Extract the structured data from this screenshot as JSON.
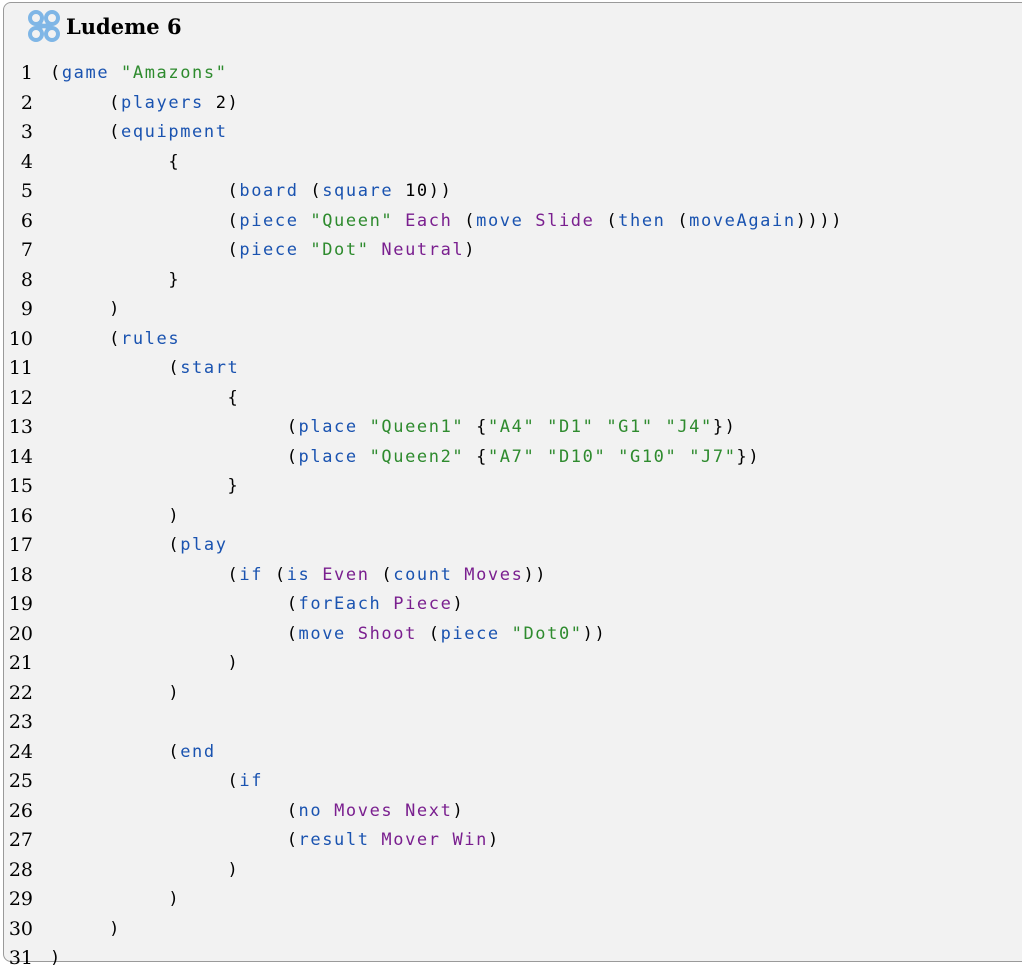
{
  "header": {
    "title": "Ludeme 6",
    "icon": "ludeme-knot-icon"
  },
  "colors": {
    "keyword": "#1a53b0",
    "string": "#2e8b2e",
    "constant": "#7a1f8f",
    "plain": "#000000",
    "background": "#f2f2f2",
    "border": "#9a9a9a"
  },
  "lines": [
    {
      "n": "1",
      "tokens": [
        [
          "p",
          "("
        ],
        [
          "k",
          "game"
        ],
        [
          "p",
          " "
        ],
        [
          "s",
          "\"Amazons\""
        ]
      ]
    },
    {
      "n": "2",
      "tokens": [
        [
          "p",
          "     ("
        ],
        [
          "k",
          "players"
        ],
        [
          "p",
          " 2)"
        ]
      ]
    },
    {
      "n": "3",
      "tokens": [
        [
          "p",
          "     ("
        ],
        [
          "k",
          "equipment"
        ]
      ]
    },
    {
      "n": "4",
      "tokens": [
        [
          "p",
          "          {"
        ]
      ]
    },
    {
      "n": "5",
      "tokens": [
        [
          "p",
          "               ("
        ],
        [
          "k",
          "board"
        ],
        [
          "p",
          " ("
        ],
        [
          "k",
          "square"
        ],
        [
          "p",
          " 10))"
        ]
      ]
    },
    {
      "n": "6",
      "tokens": [
        [
          "p",
          "               ("
        ],
        [
          "k",
          "piece"
        ],
        [
          "p",
          " "
        ],
        [
          "s",
          "\"Queen\""
        ],
        [
          "p",
          " "
        ],
        [
          "c",
          "Each"
        ],
        [
          "p",
          " ("
        ],
        [
          "k",
          "move"
        ],
        [
          "p",
          " "
        ],
        [
          "c",
          "Slide"
        ],
        [
          "p",
          " ("
        ],
        [
          "k",
          "then"
        ],
        [
          "p",
          " ("
        ],
        [
          "k",
          "moveAgain"
        ],
        [
          "p",
          "))))"
        ]
      ]
    },
    {
      "n": "7",
      "tokens": [
        [
          "p",
          "               ("
        ],
        [
          "k",
          "piece"
        ],
        [
          "p",
          " "
        ],
        [
          "s",
          "\"Dot\""
        ],
        [
          "p",
          " "
        ],
        [
          "c",
          "Neutral"
        ],
        [
          "p",
          ")"
        ]
      ]
    },
    {
      "n": "8",
      "tokens": [
        [
          "p",
          "          }"
        ]
      ]
    },
    {
      "n": "9",
      "tokens": [
        [
          "p",
          "     )"
        ]
      ]
    },
    {
      "n": "10",
      "tokens": [
        [
          "p",
          "     ("
        ],
        [
          "k",
          "rules"
        ]
      ]
    },
    {
      "n": "11",
      "tokens": [
        [
          "p",
          "          ("
        ],
        [
          "k",
          "start"
        ]
      ]
    },
    {
      "n": "12",
      "tokens": [
        [
          "p",
          "               {"
        ]
      ]
    },
    {
      "n": "13",
      "tokens": [
        [
          "p",
          "                    ("
        ],
        [
          "k",
          "place"
        ],
        [
          "p",
          " "
        ],
        [
          "s",
          "\"Queen1\""
        ],
        [
          "p",
          " {"
        ],
        [
          "s",
          "\"A4\""
        ],
        [
          "p",
          " "
        ],
        [
          "s",
          "\"D1\""
        ],
        [
          "p",
          " "
        ],
        [
          "s",
          "\"G1\""
        ],
        [
          "p",
          " "
        ],
        [
          "s",
          "\"J4\""
        ],
        [
          "p",
          "})"
        ]
      ]
    },
    {
      "n": "14",
      "tokens": [
        [
          "p",
          "                    ("
        ],
        [
          "k",
          "place"
        ],
        [
          "p",
          " "
        ],
        [
          "s",
          "\"Queen2\""
        ],
        [
          "p",
          " {"
        ],
        [
          "s",
          "\"A7\""
        ],
        [
          "p",
          " "
        ],
        [
          "s",
          "\"D10\""
        ],
        [
          "p",
          " "
        ],
        [
          "s",
          "\"G10\""
        ],
        [
          "p",
          " "
        ],
        [
          "s",
          "\"J7\""
        ],
        [
          "p",
          "})"
        ]
      ]
    },
    {
      "n": "15",
      "tokens": [
        [
          "p",
          "               }"
        ]
      ]
    },
    {
      "n": "16",
      "tokens": [
        [
          "p",
          "          )"
        ]
      ]
    },
    {
      "n": "17",
      "tokens": [
        [
          "p",
          "          ("
        ],
        [
          "k",
          "play"
        ]
      ]
    },
    {
      "n": "18",
      "tokens": [
        [
          "p",
          "               ("
        ],
        [
          "k",
          "if"
        ],
        [
          "p",
          " ("
        ],
        [
          "k",
          "is"
        ],
        [
          "p",
          " "
        ],
        [
          "c",
          "Even"
        ],
        [
          "p",
          " ("
        ],
        [
          "k",
          "count"
        ],
        [
          "p",
          " "
        ],
        [
          "c",
          "Moves"
        ],
        [
          "p",
          "))"
        ]
      ]
    },
    {
      "n": "19",
      "tokens": [
        [
          "p",
          "                    ("
        ],
        [
          "k",
          "forEach"
        ],
        [
          "p",
          " "
        ],
        [
          "c",
          "Piece"
        ],
        [
          "p",
          ")"
        ]
      ]
    },
    {
      "n": "20",
      "tokens": [
        [
          "p",
          "                    ("
        ],
        [
          "k",
          "move"
        ],
        [
          "p",
          " "
        ],
        [
          "c",
          "Shoot"
        ],
        [
          "p",
          " ("
        ],
        [
          "k",
          "piece"
        ],
        [
          "p",
          " "
        ],
        [
          "s",
          "\"Dot0\""
        ],
        [
          "p",
          "))"
        ]
      ]
    },
    {
      "n": "21",
      "tokens": [
        [
          "p",
          "               )"
        ]
      ]
    },
    {
      "n": "22",
      "tokens": [
        [
          "p",
          "          )"
        ]
      ]
    },
    {
      "n": "23",
      "tokens": []
    },
    {
      "n": "24",
      "tokens": [
        [
          "p",
          "          ("
        ],
        [
          "k",
          "end"
        ]
      ]
    },
    {
      "n": "25",
      "tokens": [
        [
          "p",
          "               ("
        ],
        [
          "k",
          "if"
        ]
      ]
    },
    {
      "n": "26",
      "tokens": [
        [
          "p",
          "                    ("
        ],
        [
          "k",
          "no"
        ],
        [
          "p",
          " "
        ],
        [
          "c",
          "Moves"
        ],
        [
          "p",
          " "
        ],
        [
          "c",
          "Next"
        ],
        [
          "p",
          ")"
        ]
      ]
    },
    {
      "n": "27",
      "tokens": [
        [
          "p",
          "                    ("
        ],
        [
          "k",
          "result"
        ],
        [
          "p",
          " "
        ],
        [
          "c",
          "Mover"
        ],
        [
          "p",
          " "
        ],
        [
          "c",
          "Win"
        ],
        [
          "p",
          ")"
        ]
      ]
    },
    {
      "n": "28",
      "tokens": [
        [
          "p",
          "               )"
        ]
      ]
    },
    {
      "n": "29",
      "tokens": [
        [
          "p",
          "          )"
        ]
      ]
    },
    {
      "n": "30",
      "tokens": [
        [
          "p",
          "     )"
        ]
      ]
    },
    {
      "n": "31",
      "tokens": [
        [
          "p",
          ")"
        ]
      ]
    }
  ]
}
